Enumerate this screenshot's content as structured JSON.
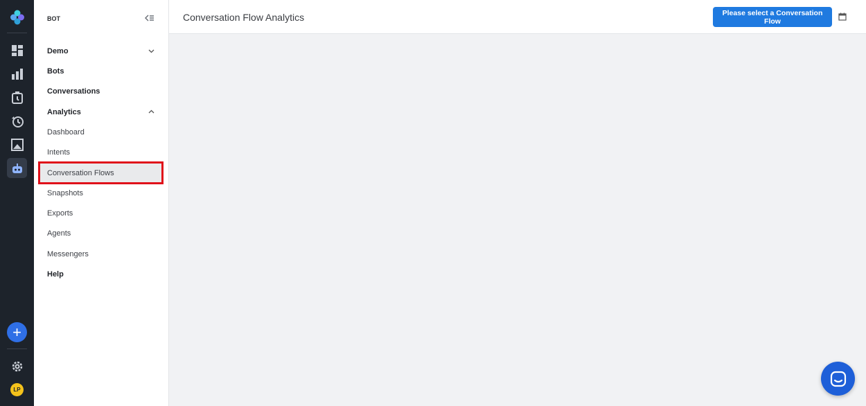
{
  "rail": {
    "icons": [
      "dashboard-icon",
      "bar-chart-icon",
      "timer-icon",
      "history-icon",
      "image-icon",
      "bot-icon"
    ],
    "active_icon": "bot-icon",
    "add_label": "+",
    "settings_icon": "gear-icon",
    "avatar_initials": "LP"
  },
  "sidebar": {
    "section_title": "BOT",
    "items": [
      {
        "label": "Demo"
      },
      {
        "label": "Bots"
      },
      {
        "label": "Conversations"
      },
      {
        "label": "Analytics"
      },
      {
        "label": "Dashboard"
      },
      {
        "label": "Intents"
      },
      {
        "label": "Conversation Flows"
      },
      {
        "label": "Snapshots"
      },
      {
        "label": "Exports"
      },
      {
        "label": "Agents"
      },
      {
        "label": "Messengers"
      },
      {
        "label": "Help"
      }
    ]
  },
  "header": {
    "title": "Conversation Flow Analytics",
    "select_button_label": "Please select a Conversation Flow"
  },
  "colors": {
    "rail_bg": "#1d232b",
    "primary": "#1f7ae0",
    "highlight_outline": "#e0101a",
    "avatar": "#f4c21b"
  }
}
